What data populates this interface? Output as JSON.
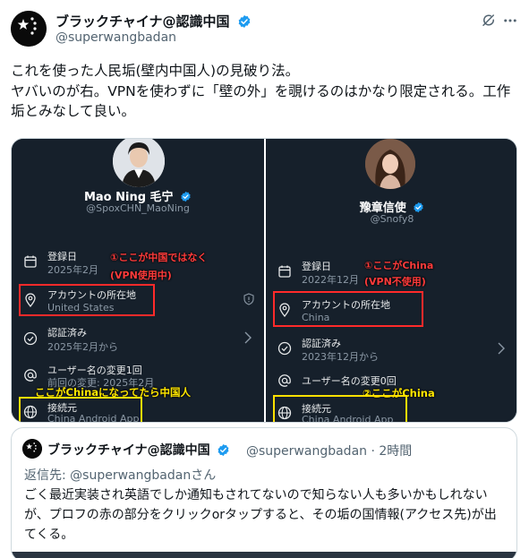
{
  "author": {
    "name": "ブラックチャイナ@認識中国",
    "handle": "@superwangbadan"
  },
  "post": {
    "lines": [
      "これを使った人民垢(壁内中国人)の見破り法。",
      "ヤバいのが右。VPNを使わずに「壁の外」を覗けるのはかなり限定される。工作垢とみなして良い。"
    ]
  },
  "left_panel": {
    "name": "Mao Ning 毛宁",
    "handle": "@SpoxCHN_MaoNing",
    "rows": [
      {
        "title": "登録日",
        "sub": "2025年2月"
      },
      {
        "title": "アカウントの所在地",
        "sub": "United States"
      },
      {
        "title": "認証済み",
        "sub": "2025年2月から"
      },
      {
        "title": "ユーザー名の変更1回",
        "sub": "前回の変更: 2025年2月"
      },
      {
        "title": "接続元",
        "sub": "China Android App"
      }
    ],
    "annotation_red_1": "①ここが中国ではなく",
    "annotation_red_2": "(VPN使用中)",
    "annotation_yellow": "ここがChinaになってたら中国人"
  },
  "right_panel": {
    "name": "豫章信使",
    "handle": "@Snofy8",
    "rows": [
      {
        "title": "登録日",
        "sub": "2022年12月"
      },
      {
        "title": "アカウントの所在地",
        "sub": "China"
      },
      {
        "title": "認証済み",
        "sub": "2023年12月から"
      },
      {
        "title": "ユーザー名の変更0回",
        "sub": ""
      },
      {
        "title": "接続元",
        "sub": "China Android App"
      }
    ],
    "annotation_red_1": "①ここがChina",
    "annotation_red_2": "(VPN不使用)",
    "annotation_yellow": "②ここがChina"
  },
  "quote": {
    "name": "ブラックチャイナ@認識中国",
    "handle_time": "@superwangbadan · 2時間",
    "reply_prefix": "返信先: ",
    "reply_handle": "@superwangbadan",
    "reply_suffix": "さん",
    "text": "ごく最近実装され英語でしか通知もされてないので知らない人も多いかもしれないが、プロフの赤の部分をクリックorタップすると、その垢の国情報(アクセス先)が出てくる。"
  },
  "colors": {
    "verified": "#1d9bf0",
    "red_annotation": "#ff2a2a",
    "yellow_annotation": "#ffe000"
  }
}
